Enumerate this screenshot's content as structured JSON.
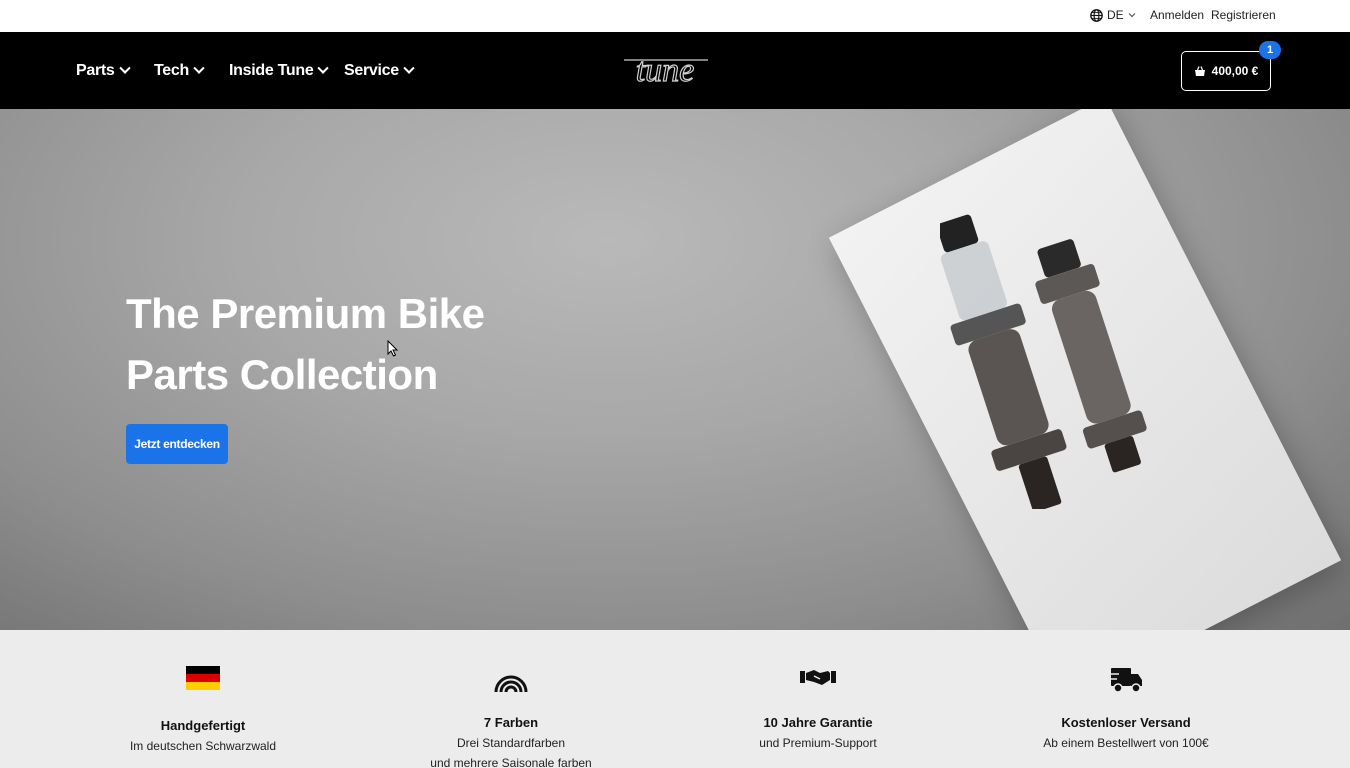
{
  "topbar": {
    "language": "DE",
    "login": "Anmelden",
    "register": "Registrieren"
  },
  "nav": {
    "items": [
      {
        "label": "Parts"
      },
      {
        "label": "Tech"
      },
      {
        "label": "Inside Tune"
      },
      {
        "label": "Service"
      }
    ],
    "logo_text": "tune",
    "cart_total": "400,00 €",
    "cart_count": "1"
  },
  "hero": {
    "title": "The Premium Bike Parts Collection",
    "cta": "Jetzt entdecken"
  },
  "features": [
    {
      "icon": "germany-flag-icon",
      "title": "Handgefertigt",
      "desc": "Im deutschen Schwarzwald",
      "desc2": ""
    },
    {
      "icon": "rainbow-icon",
      "title": "7 Farben",
      "desc": "Drei Standardfarben",
      "desc2": "und mehrere Saisonale farben"
    },
    {
      "icon": "handshake-icon",
      "title": "10 Jahre Garantie",
      "desc": "und Premium-Support",
      "desc2": ""
    },
    {
      "icon": "truck-icon",
      "title": "Kostenloser Versand",
      "desc": "Ab einem Bestellwert von 100€",
      "desc2": ""
    }
  ],
  "colors": {
    "accent": "#1a73e8",
    "nav_bg": "#000000",
    "features_bg": "#ececec"
  }
}
